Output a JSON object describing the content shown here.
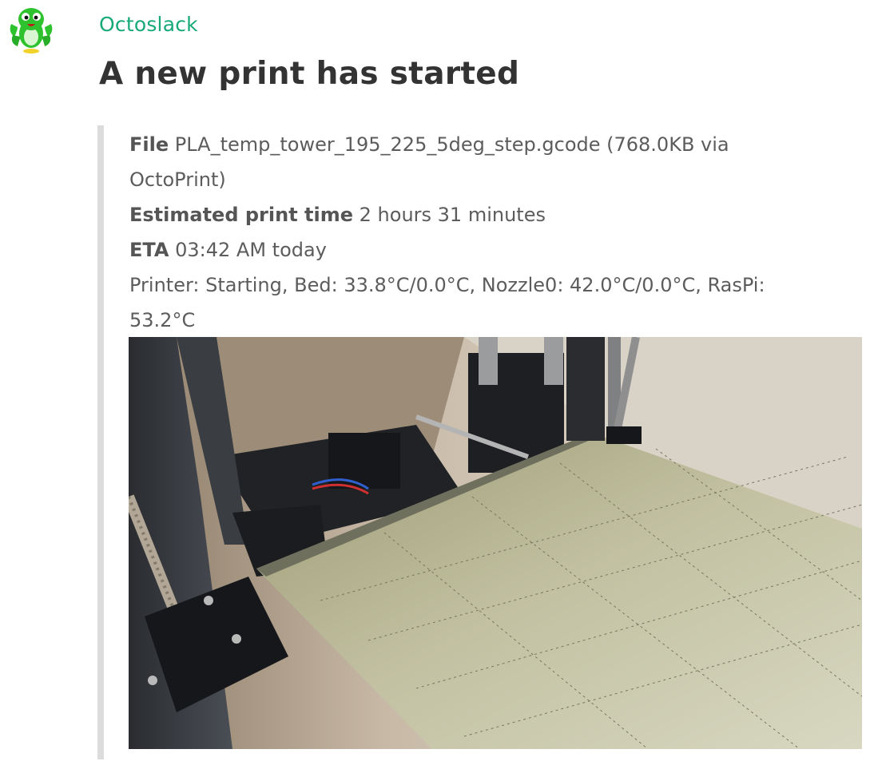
{
  "message": {
    "sender": "Octoslack",
    "title": "A new print has started"
  },
  "attachment": {
    "file_label": "File",
    "file_value": "PLA_temp_tower_195_225_5deg_step.gcode (768.0KB via OctoPrint)",
    "print_time_label": "Estimated print time",
    "print_time_value": "2 hours 31 minutes",
    "eta_label": "ETA",
    "eta_value": "03:42 AM today",
    "printer_status": "Printer: Starting, Bed: 33.8°C/0.0°C, Nozzle0: 42.0°C/0.0°C, RasPi: 53.2°C"
  },
  "icons": {
    "avatar": "octoprint-octopus-icon"
  },
  "colors": {
    "sender": "#17a97a",
    "attachment_bar": "#dcdcdc",
    "avatar_green": "#2ec22e"
  }
}
